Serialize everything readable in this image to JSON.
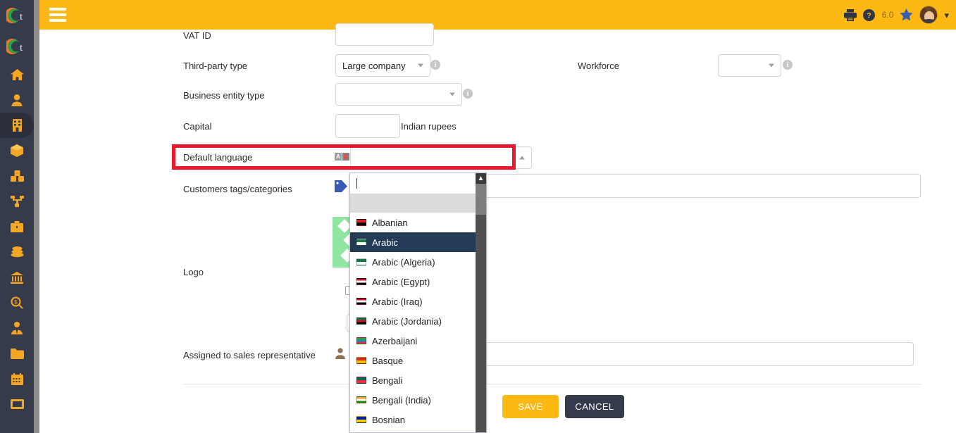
{
  "app": {
    "accent_color": "#fdb813",
    "sidebar_color": "#363b4b",
    "highlight_color": "#e8192c",
    "selected_item_color": "#243b57"
  },
  "sidebar": {
    "logo_label": "t",
    "items": [
      {
        "name": "home",
        "label": "Home"
      },
      {
        "name": "members",
        "label": "Members"
      },
      {
        "name": "third-parties",
        "label": "Third parties",
        "active": true
      },
      {
        "name": "products",
        "label": "Products"
      },
      {
        "name": "stocks",
        "label": "Stocks"
      },
      {
        "name": "projects",
        "label": "Projects"
      },
      {
        "name": "commercial",
        "label": "Commercial"
      },
      {
        "name": "billing",
        "label": "Billing"
      },
      {
        "name": "bank",
        "label": "Bank"
      },
      {
        "name": "accounting",
        "label": "Accounting"
      },
      {
        "name": "hrm",
        "label": "HRM"
      },
      {
        "name": "documents",
        "label": "Documents"
      },
      {
        "name": "agenda",
        "label": "Agenda"
      },
      {
        "name": "tickets",
        "label": "Tickets"
      }
    ]
  },
  "topbar": {
    "menu_icon": "hamburger-icon",
    "print_icon": "printer-icon",
    "help_icon": "help-circle-icon",
    "version": "6.0",
    "bookmark_icon": "star-icon",
    "avatar_icon": "user-avatar",
    "dropdown_icon": "chevron-down-icon"
  },
  "form": {
    "fields": {
      "vat_id": {
        "label": "VAT ID",
        "value": ""
      },
      "third_party_type": {
        "label": "Third-party type",
        "value": "Large company",
        "info": "i"
      },
      "workforce": {
        "label": "Workforce",
        "value": "",
        "info": "i"
      },
      "business_entity_type": {
        "label": "Business entity type",
        "value": "",
        "info": "i"
      },
      "capital": {
        "label": "Capital",
        "value": "",
        "unit": "Indian rupees"
      },
      "default_language": {
        "label": "Default language",
        "value": "",
        "translate_icon": "translate-icon"
      },
      "customers_tags": {
        "label": "Customers tags/categories",
        "value": "",
        "tag_icon": "tag-icon"
      },
      "logo": {
        "label": "Logo",
        "value": ""
      },
      "assigned_sales_rep": {
        "label": "Assigned to sales representative",
        "value": "",
        "person_icon": "person-icon"
      }
    },
    "buttons": {
      "save": "SAVE",
      "cancel": "CANCEL"
    }
  },
  "language_dropdown": {
    "search_value": "",
    "scroll_up_icon": "chevron-up-icon",
    "selected": "Arabic",
    "options": [
      {
        "label": "",
        "blank": true,
        "flag_colors": []
      },
      {
        "label": "Albanian",
        "flag_colors": [
          "#e41e20",
          "#000000"
        ]
      },
      {
        "label": "Arabic",
        "flag_colors": [
          "#1c7b3f",
          "#ffffff"
        ],
        "selected": true
      },
      {
        "label": "Arabic (Algeria)",
        "flag_colors": [
          "#14784a",
          "#ffffff"
        ]
      },
      {
        "label": "Arabic (Egypt)",
        "flag_colors": [
          "#ce1126",
          "#ffffff",
          "#000000"
        ]
      },
      {
        "label": "Arabic (Iraq)",
        "flag_colors": [
          "#ce1126",
          "#ffffff",
          "#000000"
        ]
      },
      {
        "label": "Arabic (Jordania)",
        "flag_colors": [
          "#007a3d",
          "#ce1126",
          "#000000"
        ]
      },
      {
        "label": "Azerbaijani",
        "flag_colors": [
          "#3f9c35",
          "#0092bc",
          "#ed2939"
        ]
      },
      {
        "label": "Basque",
        "flag_colors": [
          "#d52b1e",
          "#f1bf00"
        ]
      },
      {
        "label": "Bengali",
        "flag_colors": [
          "#006a4e",
          "#f42a41"
        ]
      },
      {
        "label": "Bengali (India)",
        "flag_colors": [
          "#ff9933",
          "#ffffff",
          "#138808"
        ]
      },
      {
        "label": "Bosnian",
        "flag_colors": [
          "#002395",
          "#fecb00"
        ]
      }
    ]
  }
}
